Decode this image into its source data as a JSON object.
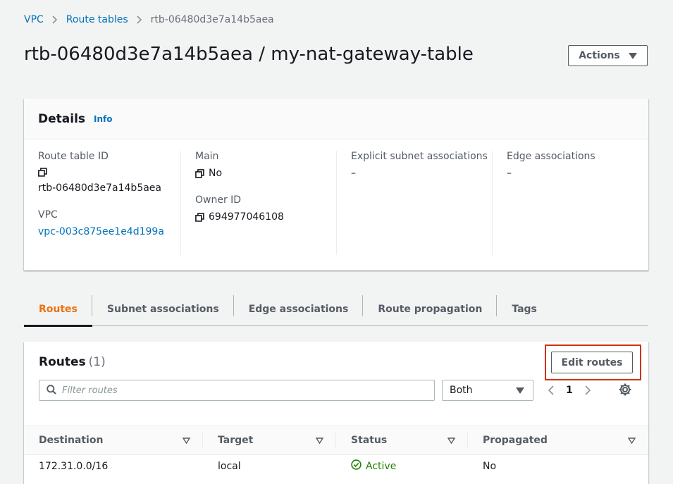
{
  "breadcrumb": {
    "items": [
      {
        "label": "VPC"
      },
      {
        "label": "Route tables"
      },
      {
        "label": "rtb-06480d3e7a14b5aea"
      }
    ]
  },
  "header": {
    "title": "rtb-06480d3e7a14b5aea / my-nat-gateway-table",
    "actions_label": "Actions"
  },
  "details": {
    "title": "Details",
    "info_label": "Info",
    "route_table_id_key": "Route table ID",
    "route_table_id_value": "rtb-06480d3e7a14b5aea",
    "vpc_key": "VPC",
    "vpc_value": "vpc-003c875ee1e4d199a",
    "main_key": "Main",
    "main_value": "No",
    "owner_id_key": "Owner ID",
    "owner_id_value": "694977046108",
    "explicit_subnet_key": "Explicit subnet associations",
    "explicit_subnet_value": "–",
    "edge_key": "Edge associations",
    "edge_value": "–"
  },
  "tabs": [
    {
      "label": "Routes",
      "active": true
    },
    {
      "label": "Subnet associations"
    },
    {
      "label": "Edge associations"
    },
    {
      "label": "Route propagation"
    },
    {
      "label": "Tags"
    }
  ],
  "routes": {
    "title": "Routes",
    "count": "(1)",
    "edit_label": "Edit routes",
    "filter_placeholder": "Filter routes",
    "select_value": "Both",
    "page_number": "1",
    "columns": [
      "Destination",
      "Target",
      "Status",
      "Propagated"
    ],
    "rows": [
      {
        "destination": "172.31.0.0/16",
        "target": "local",
        "status": "Active",
        "propagated": "No"
      }
    ]
  },
  "colors": {
    "link": "#0073bb",
    "active_tab": "#ec7211",
    "status_active": "#1d8102",
    "highlight": "#d13212"
  }
}
